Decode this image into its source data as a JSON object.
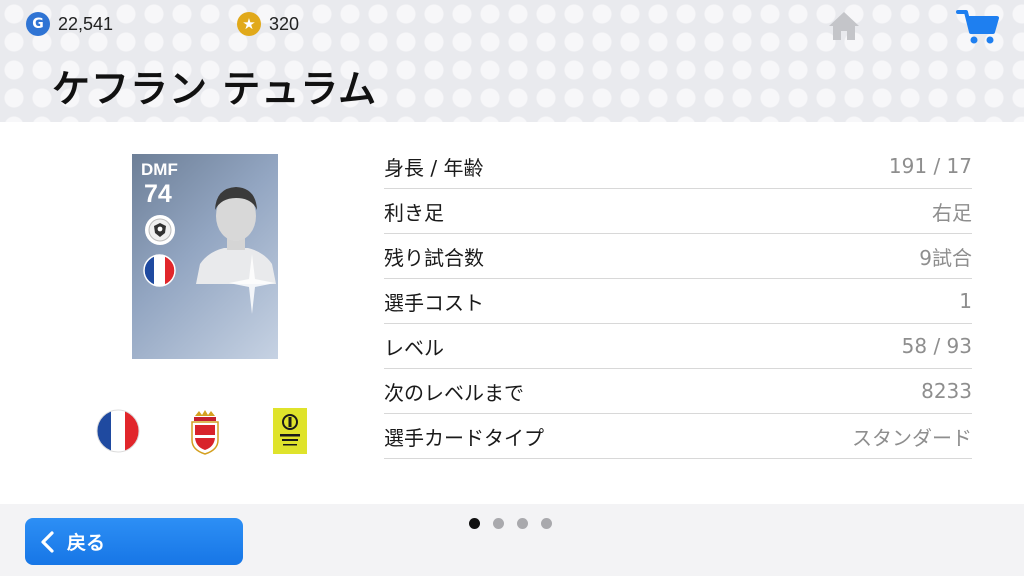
{
  "header": {
    "gp": {
      "icon": "gp-icon",
      "icon_glyph": "G",
      "value": "22,541"
    },
    "coins": {
      "icon": "coin-star-icon",
      "icon_glyph": "★",
      "value": "320"
    },
    "home_icon": "home-icon",
    "cart_icon": "cart-icon"
  },
  "player": {
    "name": "ケフラン テュラム",
    "card": {
      "position": "DMF",
      "rating": "74"
    }
  },
  "stats": [
    {
      "label": "身長 / 年齢",
      "value": "191 / 17"
    },
    {
      "label": "利き足",
      "value": "右足"
    },
    {
      "label": "残り試合数",
      "value": "9試合"
    },
    {
      "label": "選手コスト",
      "value": "1"
    },
    {
      "label": "レベル",
      "value": "58 / 93"
    },
    {
      "label": "次のレベルまで",
      "value": "8233"
    },
    {
      "label": "選手カードタイプ",
      "value": "スタンダード"
    }
  ],
  "pagination": {
    "total": 4,
    "current": 1
  },
  "footer": {
    "back_label": "戻る"
  },
  "colors": {
    "accent": "#1e7ff0",
    "gp": "#2f74d4",
    "coin": "#e1a91a",
    "france_blue": "#1f4aa0",
    "france_red": "#e1262b"
  }
}
